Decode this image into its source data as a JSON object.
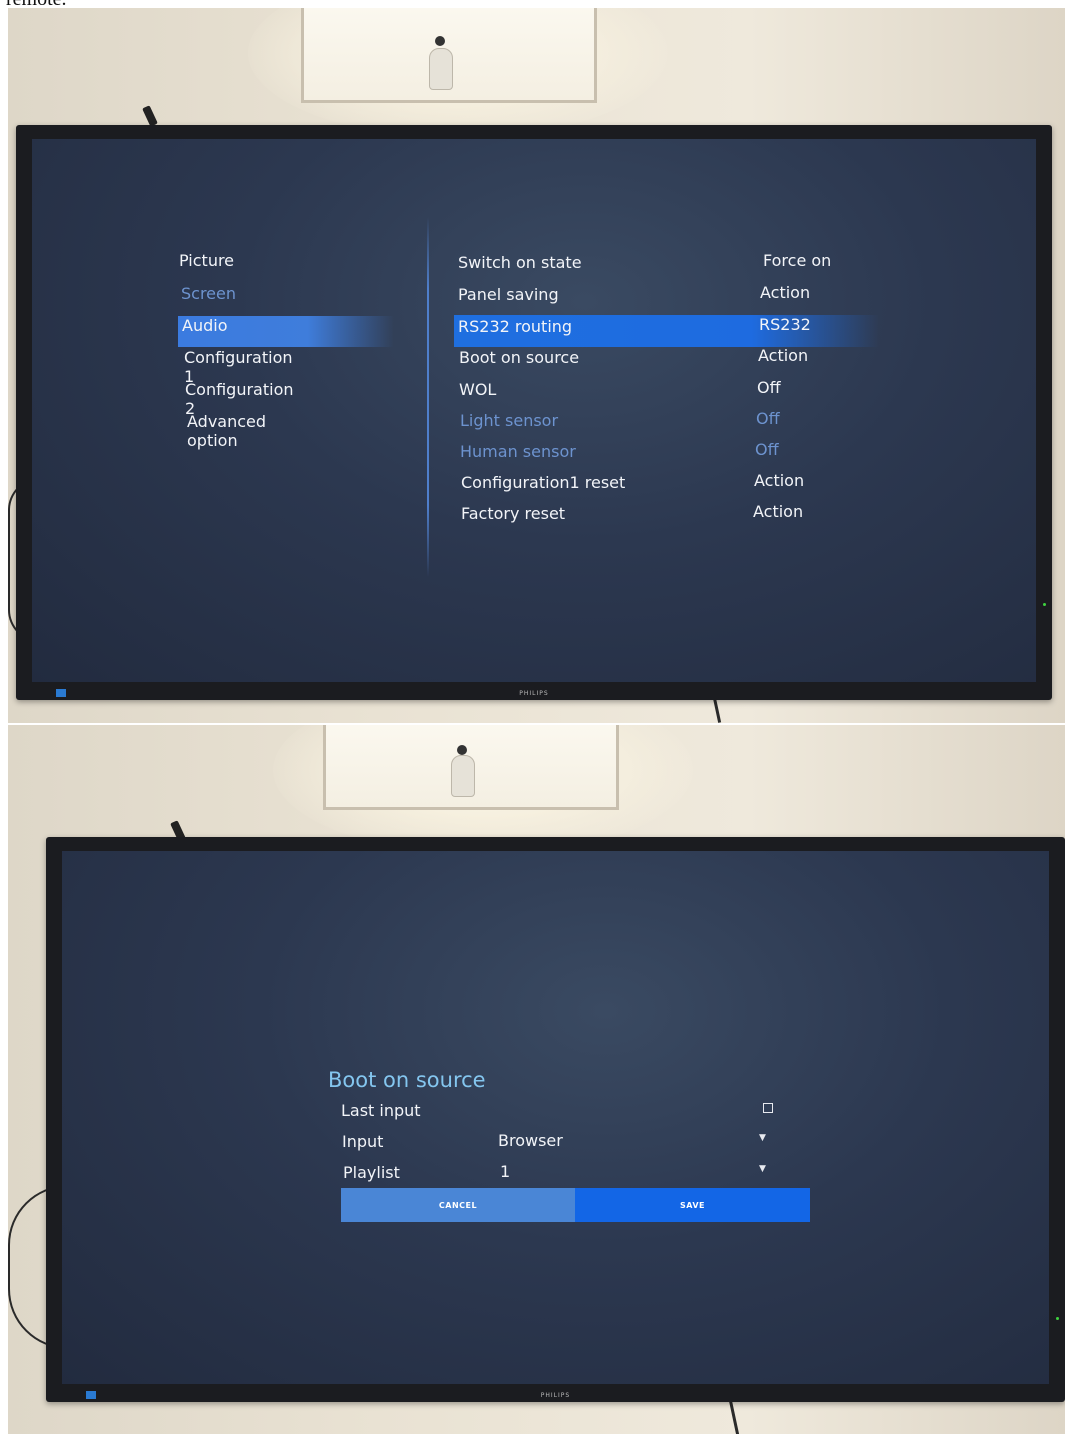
{
  "caption_fragment": "remote.",
  "tv_brand": "PHILIPS",
  "settings_menu": {
    "left_items": [
      {
        "label": "Picture",
        "state": "normal"
      },
      {
        "label": "Screen",
        "state": "dim"
      },
      {
        "label": "Audio",
        "state": "normal"
      },
      {
        "label": "Configuration 1",
        "state": "selected"
      },
      {
        "label": "Configuration 2",
        "state": "normal"
      },
      {
        "label": "Advanced option",
        "state": "normal"
      }
    ],
    "rows": [
      {
        "label": "Switch on state",
        "value": "Force on",
        "state": "normal"
      },
      {
        "label": "Panel saving",
        "value": "Action",
        "state": "normal"
      },
      {
        "label": "RS232 routing",
        "value": "RS232",
        "state": "normal"
      },
      {
        "label": "Boot on source",
        "value": "Action",
        "state": "selected"
      },
      {
        "label": "WOL",
        "value": "Off",
        "state": "normal"
      },
      {
        "label": "Light sensor",
        "value": "Off",
        "state": "dim"
      },
      {
        "label": "Human sensor",
        "value": "Off",
        "state": "dim"
      },
      {
        "label": "Configuration1 reset",
        "value": "Action",
        "state": "normal"
      },
      {
        "label": "Factory reset",
        "value": "Action",
        "state": "normal"
      }
    ]
  },
  "dialog": {
    "title": "Boot on source",
    "last_input_label": "Last input",
    "last_input_checked": false,
    "input_label": "Input",
    "input_value": "Browser",
    "playlist_label": "Playlist",
    "playlist_value": "1",
    "cancel_label": "CANCEL",
    "save_label": "SAVE"
  },
  "colors": {
    "highlight": "#1e6be0",
    "dim_text": "#6d93cf",
    "dialog_title": "#84c6ef",
    "save_button": "#1366e6",
    "cancel_button": "#4a86d6"
  }
}
